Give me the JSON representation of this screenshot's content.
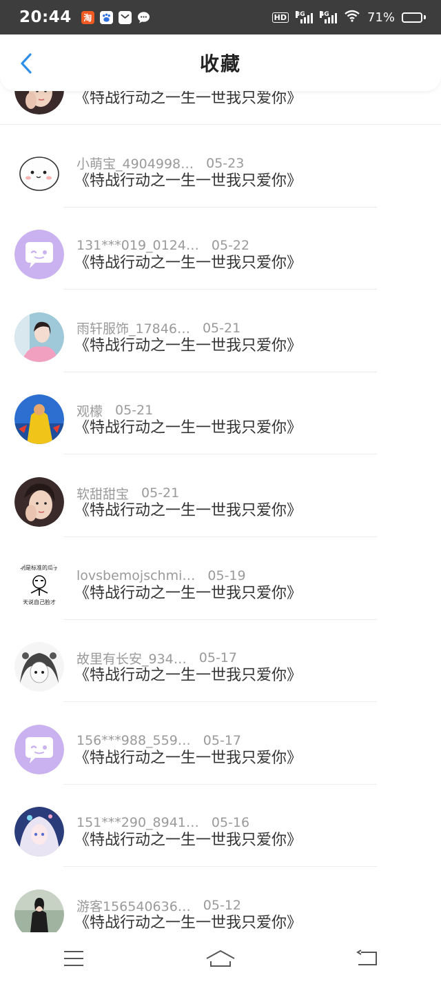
{
  "status_bar": {
    "time": "20:44",
    "network_1": "3G",
    "network_2": "4G",
    "hd": "HD",
    "battery_text": "71%",
    "battery_level": 0.71,
    "apps": [
      "taobao-icon",
      "baidu-icon",
      "mail-icon",
      "message-icon"
    ]
  },
  "header": {
    "title": "收藏",
    "back_icon": "chevron-left-icon"
  },
  "colors": {
    "accent": "#2f8fe8",
    "status_bar_bg": "#3d3d3d",
    "meta_text": "#9a9a9a",
    "title_text": "#333333",
    "default_avatar": "#c9b2ef"
  },
  "items": [
    {
      "name": "",
      "date": "",
      "book": "《特战行动之一生一世我只爱你》",
      "avatar": "photo-girl-dark"
    },
    {
      "name": "小萌宝_4904998…",
      "date": "05-23",
      "book": "《特战行动之一生一世我只爱你》",
      "avatar": "cartoon-bun"
    },
    {
      "name": "131***019_0124…",
      "date": "05-22",
      "book": "《特战行动之一生一世我只爱你》",
      "avatar": "default-chat"
    },
    {
      "name": "雨轩服饰_17846…",
      "date": "05-21",
      "book": "《特战行动之一生一世我只爱你》",
      "avatar": "photo-pink"
    },
    {
      "name": "观檬",
      "date": "05-21",
      "book": "《特战行动之一生一世我只爱你》",
      "avatar": "photo-yellow"
    },
    {
      "name": "软甜甜宝",
      "date": "05-21",
      "book": "《特战行动之一生一世我只爱你》",
      "avatar": "photo-girl-dark"
    },
    {
      "name": "lovsbemojschmi…",
      "date": "05-19",
      "book": "《特战行动之一生一世我只爱你》",
      "avatar": "meme-sketch"
    },
    {
      "name": "故里有长安_934…",
      "date": "05-17",
      "book": "《特战行动之一生一世我只爱你》",
      "avatar": "anime-sketch"
    },
    {
      "name": "156***988_559…",
      "date": "05-17",
      "book": "《特战行动之一生一世我只爱你》",
      "avatar": "default-chat"
    },
    {
      "name": "151***290_8941…",
      "date": "05-16",
      "book": "《特战行动之一生一世我只爱你》",
      "avatar": "anime-blue"
    },
    {
      "name": "游客156540636…",
      "date": "05-12",
      "book": "《特战行动之一生一世我只爱你》",
      "avatar": "photo-street"
    }
  ],
  "nav": {
    "menu_icon": "menu-icon",
    "home_icon": "home-icon",
    "back_icon": "back-icon"
  }
}
